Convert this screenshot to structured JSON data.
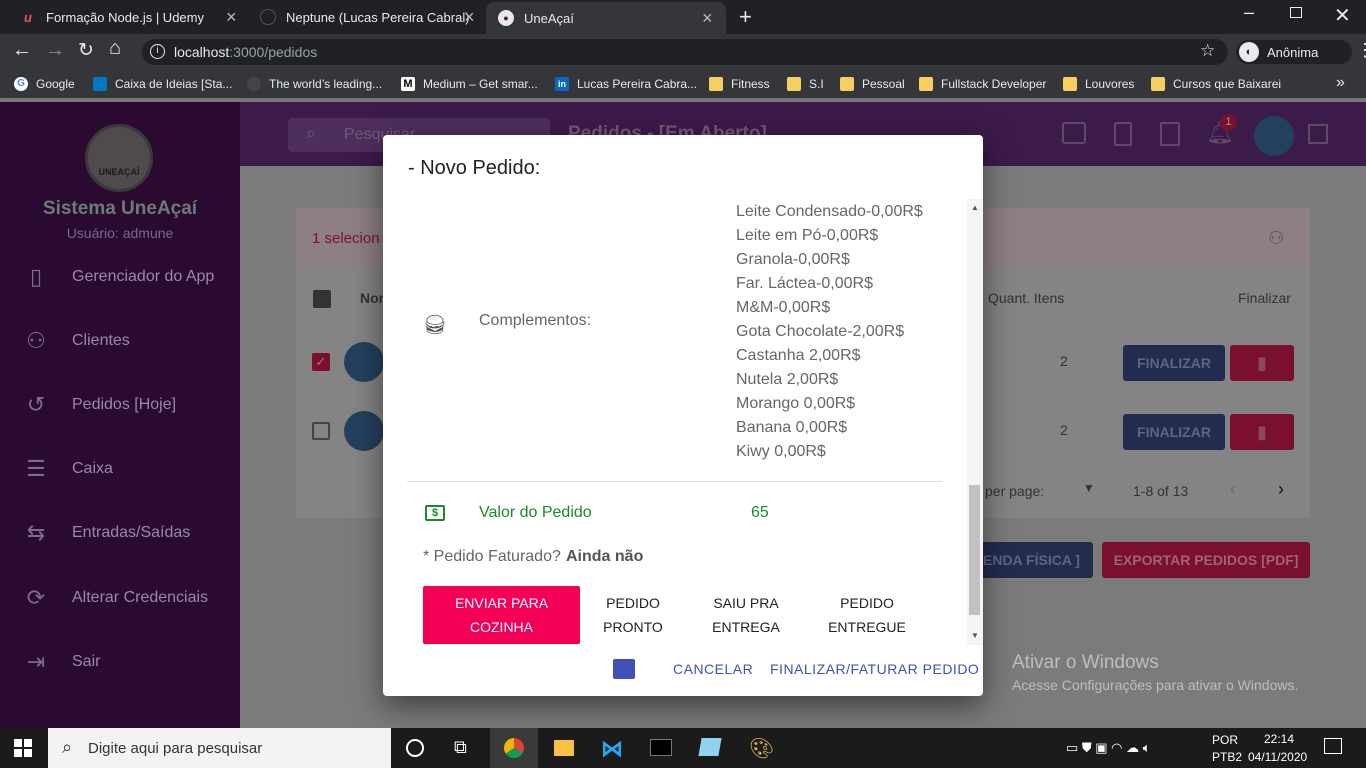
{
  "browser": {
    "tabs": [
      {
        "title": "Formação Node.js | Udemy"
      },
      {
        "title": "Neptune (Lucas Pereira Cabral)"
      },
      {
        "title": "UneAçaí"
      }
    ],
    "url_host": "localhost",
    "url_path": ":3000/pedidos",
    "profile_label": "Anônima",
    "bookmarks": [
      {
        "label": "Google",
        "icon": "google-icon"
      },
      {
        "label": "Caixa de Ideias [Sta...",
        "icon": "trello-icon"
      },
      {
        "label": "The world’s leading...",
        "icon": "github-icon"
      },
      {
        "label": "Medium – Get smar...",
        "icon": "medium-icon"
      },
      {
        "label": "Lucas Pereira Cabra...",
        "icon": "linkedin-icon"
      },
      {
        "label": "Fitness",
        "icon": "folder-icon"
      },
      {
        "label": "S.I",
        "icon": "folder-icon"
      },
      {
        "label": "Pessoal",
        "icon": "folder-icon"
      },
      {
        "label": "Fullstack Developer",
        "icon": "folder-icon"
      },
      {
        "label": "Louvores",
        "icon": "folder-icon"
      },
      {
        "label": "Cursos que Baixarei",
        "icon": "folder-icon"
      }
    ]
  },
  "app": {
    "brand_logo_text": "UNEAÇAÍ",
    "brand": "Sistema UneAçaí",
    "user": "Usuário: admune",
    "search_placeholder": "Pesquisar",
    "page_title": "Pedidos - [Em Aberto]",
    "notification_count": "1",
    "selected_text": "1 selecion",
    "table_col_name": "Nor",
    "table_col_qty": "Quant. Itens",
    "table_col_finalize": "Finalizar",
    "rows": [
      {
        "qty": "2",
        "btn": "FINALIZAR"
      },
      {
        "qty": "2",
        "btn": "FINALIZAR"
      }
    ],
    "per_page": "per page:",
    "pagination": "1-8 of 13",
    "btn_venda": "ENDA FÍSICA ]",
    "btn_export": "EXPORTAR PEDIDOS [PDF]",
    "menu": [
      {
        "label": "Gerenciador do App"
      },
      {
        "label": "Clientes"
      },
      {
        "label": "Pedidos [Hoje]"
      },
      {
        "label": "Caixa"
      },
      {
        "label": "Entradas/Saídas"
      },
      {
        "label": "Alterar Credenciais"
      },
      {
        "label": "Sair"
      }
    ]
  },
  "dialog": {
    "title": "- Novo Pedido:",
    "complementos_label": "Complementos:",
    "complementos": [
      "Leite Condensado-0,00R$",
      "Leite em Pó-0,00R$",
      "Granola-0,00R$",
      "Far. Láctea-0,00R$",
      "M&M-0,00R$",
      "Gota Chocolate-2,00R$",
      "Castanha 2,00R$",
      "Nutela 2,00R$",
      "Morango 0,00R$",
      "Banana 0,00R$",
      "Kiwy 0,00R$"
    ],
    "valor_label": "Valor do Pedido",
    "valor": "65",
    "faturado_q": "* Pedido Faturado?",
    "faturado_a": "Ainda não",
    "status_buttons": [
      {
        "line1": "ENVIAR PARA",
        "line2": "COZINHA"
      },
      {
        "line1": "PEDIDO",
        "line2": "PRONTO"
      },
      {
        "line1": "SAIU PRA",
        "line2": "ENTREGA"
      },
      {
        "line1": "PEDIDO",
        "line2": "ENTREGUE"
      }
    ],
    "cancel_label": "CANCELAR",
    "finalize_label": "FINALIZAR/FATURAR PEDIDO"
  },
  "windows": {
    "activate_title": "Ativar o Windows",
    "activate_sub": "Acesse Configurações para ativar o Windows.",
    "search_placeholder": "Digite aqui para pesquisar",
    "lang1": "POR",
    "lang2": "PTB2",
    "time": "22:14",
    "date": "04/11/2020"
  },
  "colors": {
    "accent": "#f50057",
    "primary": "#3f51b5",
    "green": "#1b8a2a",
    "purple": "#2a0a30"
  }
}
